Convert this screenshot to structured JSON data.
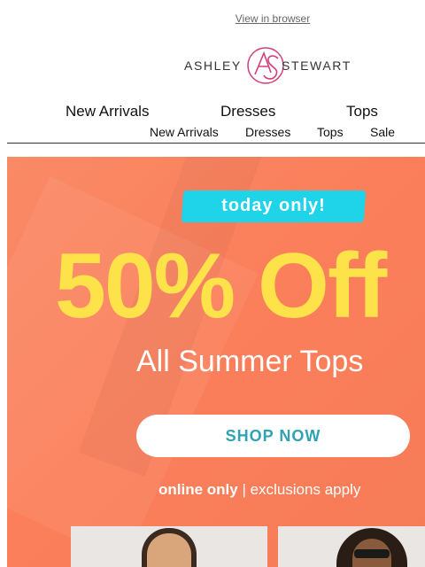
{
  "header": {
    "view_in_browser": "View in browser",
    "logo_left": "ASHLEY",
    "logo_right": "STEWART",
    "logo_monogram": "AS"
  },
  "nav_primary": [
    "New Arrivals",
    "Dresses",
    "Tops"
  ],
  "nav_secondary": [
    "New Arrivals",
    "Dresses",
    "Tops",
    "Sale"
  ],
  "hero": {
    "badge": "today only!",
    "headline": "50% Off",
    "subheadline": "All Summer Tops",
    "cta": "SHOP NOW",
    "fine_bold": "online only",
    "fine_rest": " | exclusions apply",
    "colors": {
      "background": "#fb7f5b",
      "headline": "#fde24a",
      "badge": "#1fd3e8",
      "cta_text": "#2fa3b4"
    }
  },
  "brand_color": "#d43d7c"
}
